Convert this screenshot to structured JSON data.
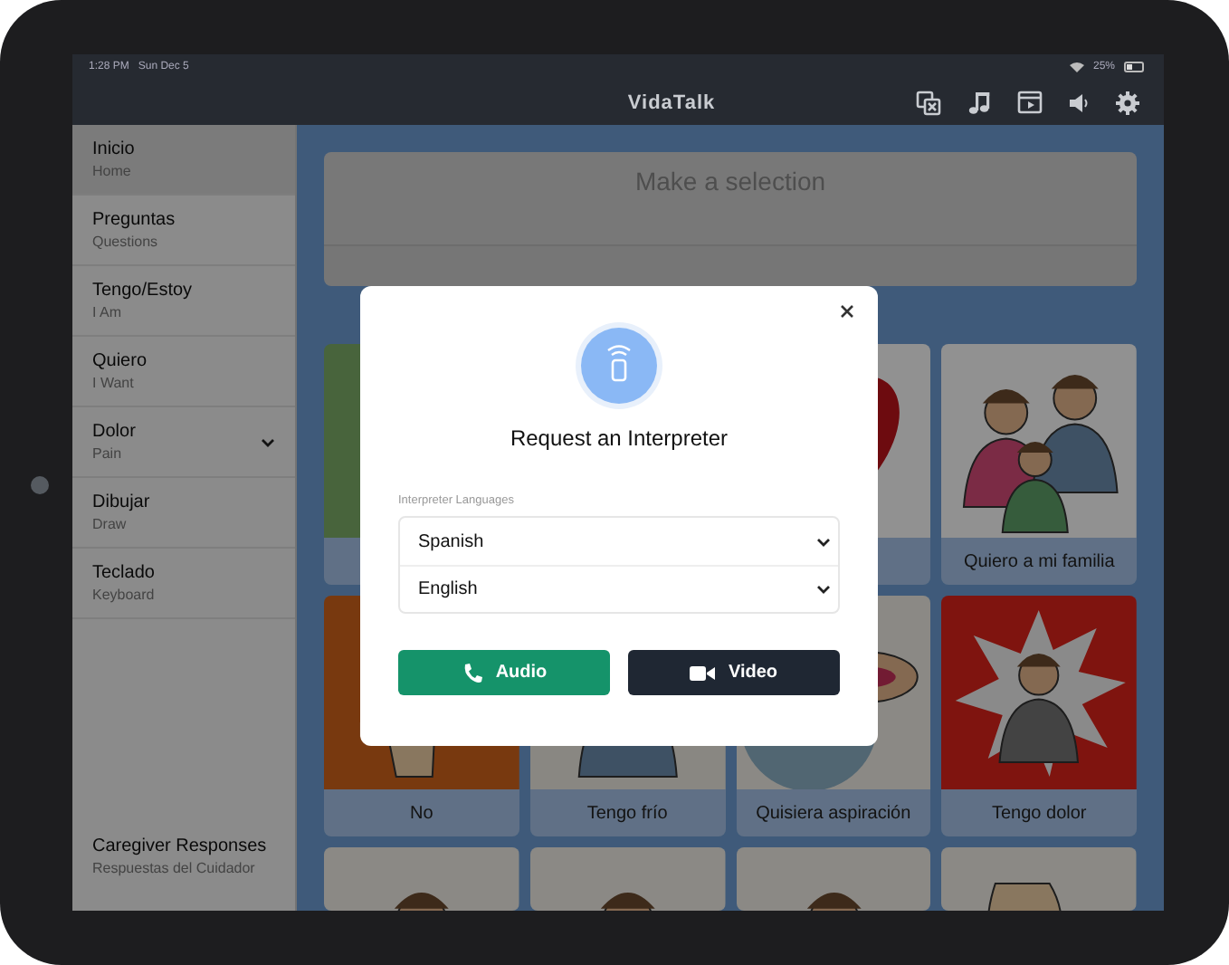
{
  "status_bar": {
    "time": "1:28 PM",
    "date": "Sun Dec 5",
    "battery": "25%"
  },
  "header": {
    "title": "VidaTalk"
  },
  "sidebar": {
    "items": [
      {
        "label": "Inicio",
        "sublabel": "Home",
        "selected": true,
        "expandable": false
      },
      {
        "label": "Preguntas",
        "sublabel": "Questions",
        "selected": false,
        "expandable": false
      },
      {
        "label": "Tengo/Estoy",
        "sublabel": "I Am",
        "selected": false,
        "expandable": false
      },
      {
        "label": "Quiero",
        "sublabel": "I Want",
        "selected": false,
        "expandable": false
      },
      {
        "label": "Dolor",
        "sublabel": "Pain",
        "selected": false,
        "expandable": true
      },
      {
        "label": "Dibujar",
        "sublabel": "Draw",
        "selected": false,
        "expandable": false
      },
      {
        "label": "Teclado",
        "sublabel": "Keyboard",
        "selected": false,
        "expandable": false
      }
    ],
    "footer_item": {
      "label": "Caregiver Responses",
      "sublabel": "Respuestas del Cuidador"
    }
  },
  "selection_bar": {
    "placeholder": "Make a selection"
  },
  "tiles": [
    {
      "kind": "picture"
    },
    {
      "kind": "picture"
    },
    {
      "kind": "picture",
      "label": "Quiero a mi familia"
    },
    {
      "kind": "picture",
      "label": "No"
    },
    {
      "kind": "picture",
      "label": "Tengo frío"
    },
    {
      "kind": "picture",
      "label": "Quisiera aspiración"
    },
    {
      "kind": "picture",
      "label": "Tengo dolor"
    },
    {
      "kind": "picture"
    },
    {
      "kind": "picture"
    },
    {
      "kind": "picture"
    },
    {
      "kind": "picture"
    }
  ],
  "modal": {
    "title": "Request an Interpreter",
    "field_label": "Interpreter Languages",
    "languages": [
      {
        "value": "Spanish"
      },
      {
        "value": "English"
      }
    ],
    "buttons": [
      {
        "label": "Audio",
        "kind": "audio"
      },
      {
        "label": "Video",
        "kind": "video"
      }
    ]
  }
}
